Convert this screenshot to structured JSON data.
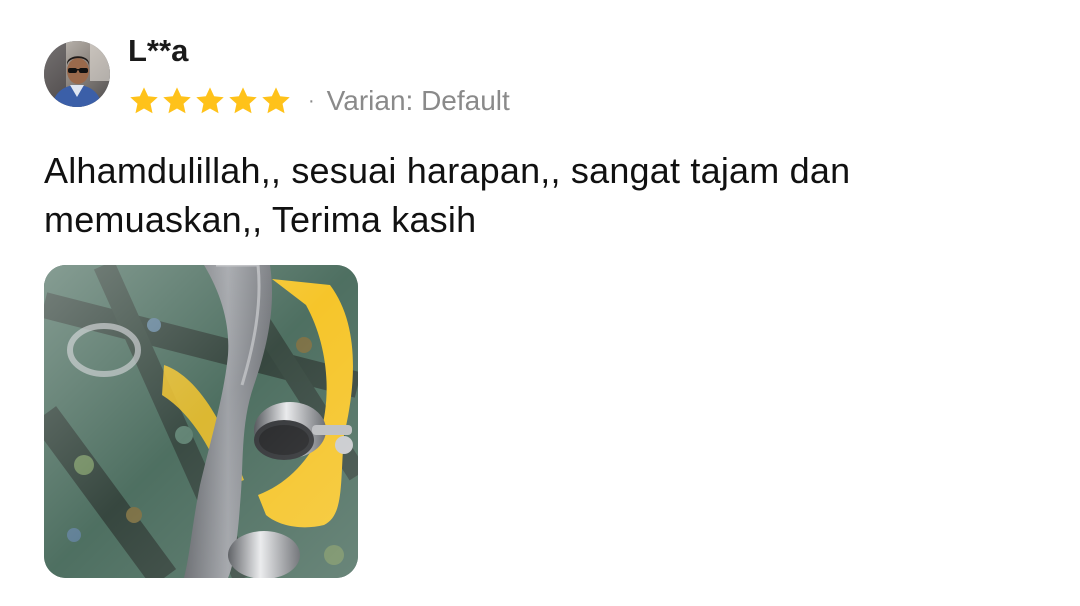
{
  "review": {
    "reviewer_name": "L**a",
    "rating": 5,
    "max_rating": 5,
    "separator": "·",
    "variant_label": "Varian: Default",
    "text": "Alhamdulillah,, sesuai harapan,, sangat tajam dan memuaskan,, Terima kasih"
  },
  "colors": {
    "star": "#FFC21A",
    "secondary_text": "#8A8A8A",
    "primary_text": "#111111"
  },
  "icons": {
    "avatar": "user-avatar",
    "star": "star-icon"
  }
}
